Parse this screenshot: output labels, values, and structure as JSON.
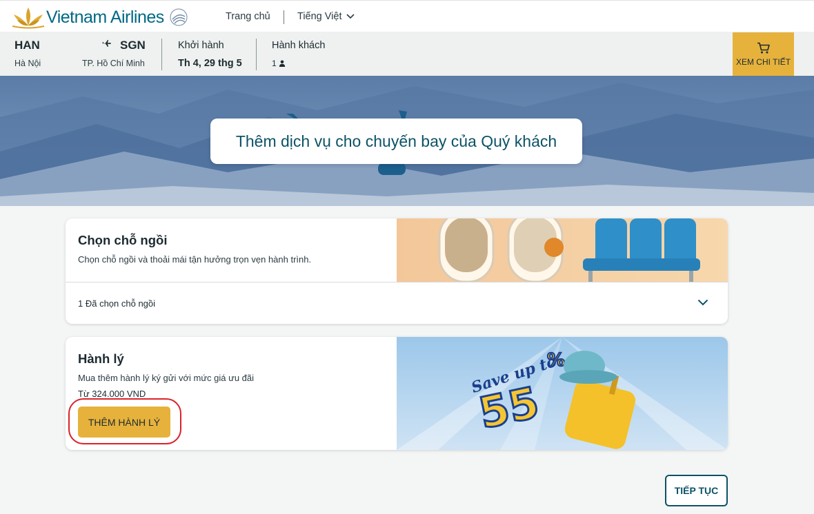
{
  "brand": {
    "name": "Vietnam Airlines",
    "alliance_icon": "skyteam-icon"
  },
  "nav": {
    "home": "Trang chủ",
    "language": "Tiếng Việt"
  },
  "flight": {
    "origin_code": "HAN",
    "origin_city": "Hà Nội",
    "dest_code": "SGN",
    "dest_city": "TP. Hồ Chí Minh",
    "depart_label": "Khởi hành",
    "depart_date": "Th 4, 29 thg 5",
    "pax_label": "Hành khách",
    "pax_count": "1"
  },
  "cart": {
    "label": "XEM CHI TIẾT"
  },
  "hero": {
    "title": "Thêm dịch vụ cho chuyến bay của Quý khách"
  },
  "seat": {
    "title": "Chọn chỗ ngồi",
    "desc": "Chọn chỗ ngồi và thoải mái tận hưởng trọn vẹn hành trình.",
    "status": "1 Đã chọn chỗ ngồi"
  },
  "baggage": {
    "title": "Hành lý",
    "desc": "Mua thêm hành lý ký gửi với mức giá ưu đãi",
    "price": "Từ 324.000 VND",
    "button": "THÊM HÀNH LÝ",
    "promo_line1": "Save up to",
    "promo_value": "55",
    "promo_unit": "%"
  },
  "footer": {
    "continue": "TIẾP TỤC"
  },
  "colors": {
    "brand_teal": "#0b5266",
    "gold": "#e6b23c",
    "highlight_red": "#d9222a"
  }
}
